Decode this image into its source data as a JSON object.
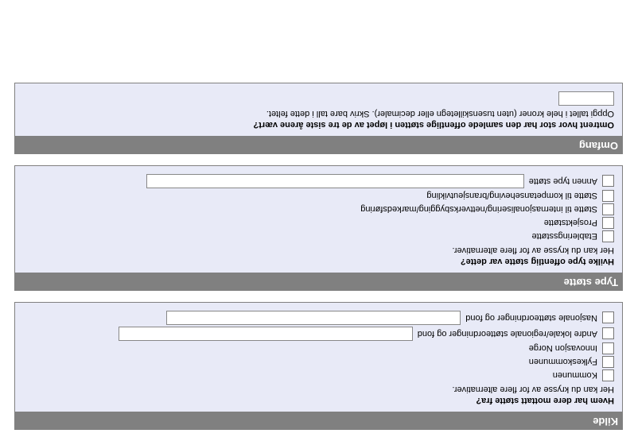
{
  "kilde": {
    "bar": "Kilde",
    "question": "Hvem har dere mottatt støtte fra?",
    "hint": "Her kan du krysse av for flere alternativer.",
    "items": {
      "kommunen": "Kommunen",
      "fylkeskommunen": "Fylkeskommunen",
      "innovasjon_norge": "Innovasjon Norge",
      "andre_lokale": "Andre lokale/regionale støtteordninger og fond",
      "nasjonale": "Nasjonale støtteordninger og fond"
    }
  },
  "type": {
    "bar": "Type støtte",
    "question": "Hvilke type offentlig støtte var dette?",
    "hint": "Her kan du krysse av for flere alternativer.",
    "items": {
      "etablering": "Etableringsstøtte",
      "prosjekt": "Prosjektstøtte",
      "internasjonalisering": "Støtte til internasjonalisering/nettverksbygging/markedsføring",
      "kompetanse": "Støtte til kompetanseheving/bransjeutvikling",
      "annen": "Annen type støtte"
    }
  },
  "omfang": {
    "bar": "Omfang",
    "question": "Omtrent hvor stor har den samlede offentlige støtten i løpet av de tre siste årene vært?",
    "hint": "Oppgi tallet i hele kroner (uten tusenskilletegn eller decimaler). Skriv bare tall i dette feltet."
  }
}
